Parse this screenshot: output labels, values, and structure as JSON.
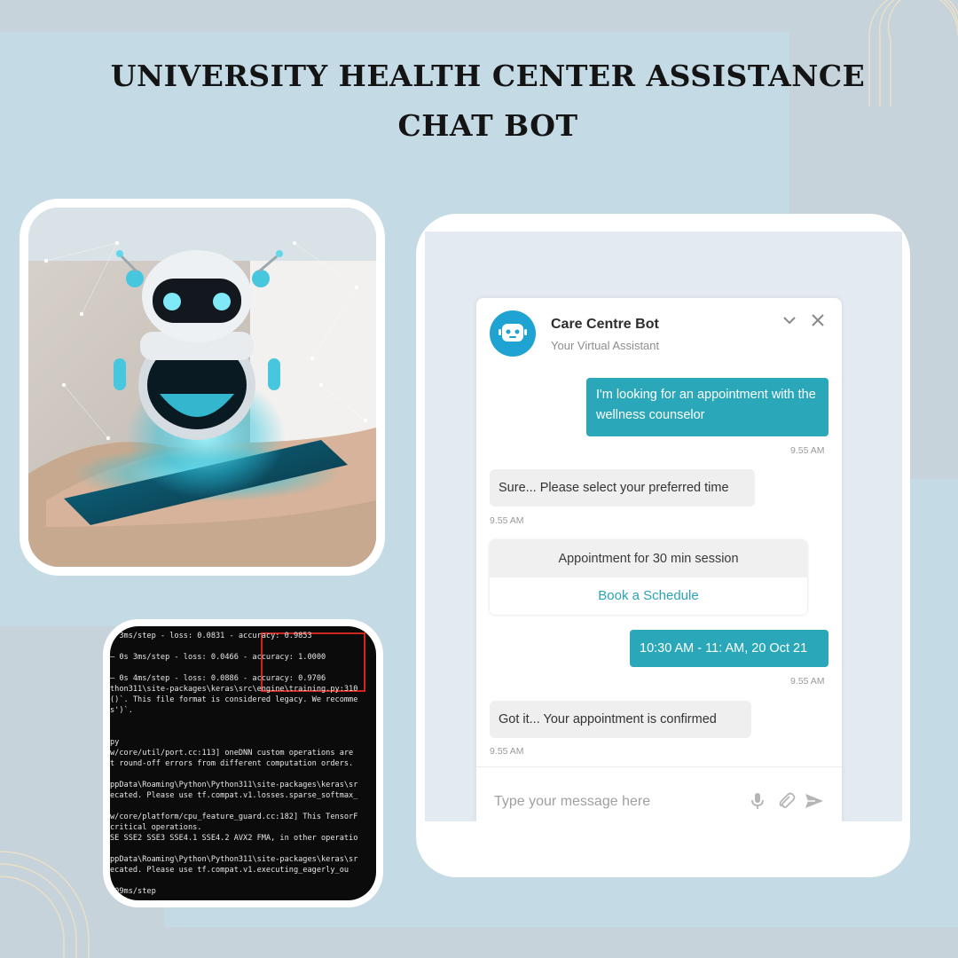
{
  "title": "UNIVERSITY HEALTH CENTER ASSISTANCE CHAT BOT",
  "terminal": {
    "lines": [
      "– 3ms/step - loss: 0.0831 - accuracy: 0.9853",
      "",
      "– 0s 3ms/step - loss: 0.0466 - accuracy: 1.0000",
      "",
      "– 0s 4ms/step - loss: 0.0886 - accuracy: 0.9706",
      "thon311\\site-packages\\keras\\src\\engine\\training.py:310",
      "()`. This file format is considered legacy. We recomme",
      "s')`.",
      "",
      "",
      "py",
      "w/core/util/port.cc:113] oneDNN custom operations are",
      "t round-off errors from different computation orders.",
      "",
      "ppData\\Roaming\\Python\\Python311\\site-packages\\keras\\sr",
      "ecated. Please use tf.compat.v1.losses.sparse_softmax_",
      "",
      "w/core/platform/cpu_feature_guard.cc:182] This TensorF",
      "critical operations.",
      "SE SSE2 SSE3 SSE4.1 SSE4.2 AVX2 FMA, in other operatio",
      "",
      "ppData\\Roaming\\Python\\Python311\\site-packages\\keras\\sr",
      "ecated. Please use tf.compat.v1.executing_eagerly_ou",
      "",
      "109ms/step"
    ]
  },
  "chat": {
    "bot_name": "Care Centre Bot",
    "bot_subtitle": "Your Virtual Assistant",
    "msg1": "I'm looking for an appointment with the wellness counselor",
    "ts1": "9.55 AM",
    "msg2": "Sure... Please select your preferred time",
    "ts2": "9.55 AM",
    "appointment_title": "Appointment for 30 min session",
    "appointment_link": "Book a Schedule",
    "msg3": "10:30 AM - 11: AM, 20 Oct 21",
    "ts3": "9.55 AM",
    "msg4": "Got it... Your appointment is confirmed",
    "ts4": "9.55 AM",
    "input_placeholder": "Type your message here"
  },
  "icons": {
    "collapse": "chevron-down-icon",
    "close": "close-icon",
    "mic": "microphone-icon",
    "attach": "paperclip-icon",
    "send": "send-icon"
  },
  "colors": {
    "user_bubble": "#2aa7b8",
    "avatar": "#1fa3d2",
    "background": "#c4dbe5"
  }
}
